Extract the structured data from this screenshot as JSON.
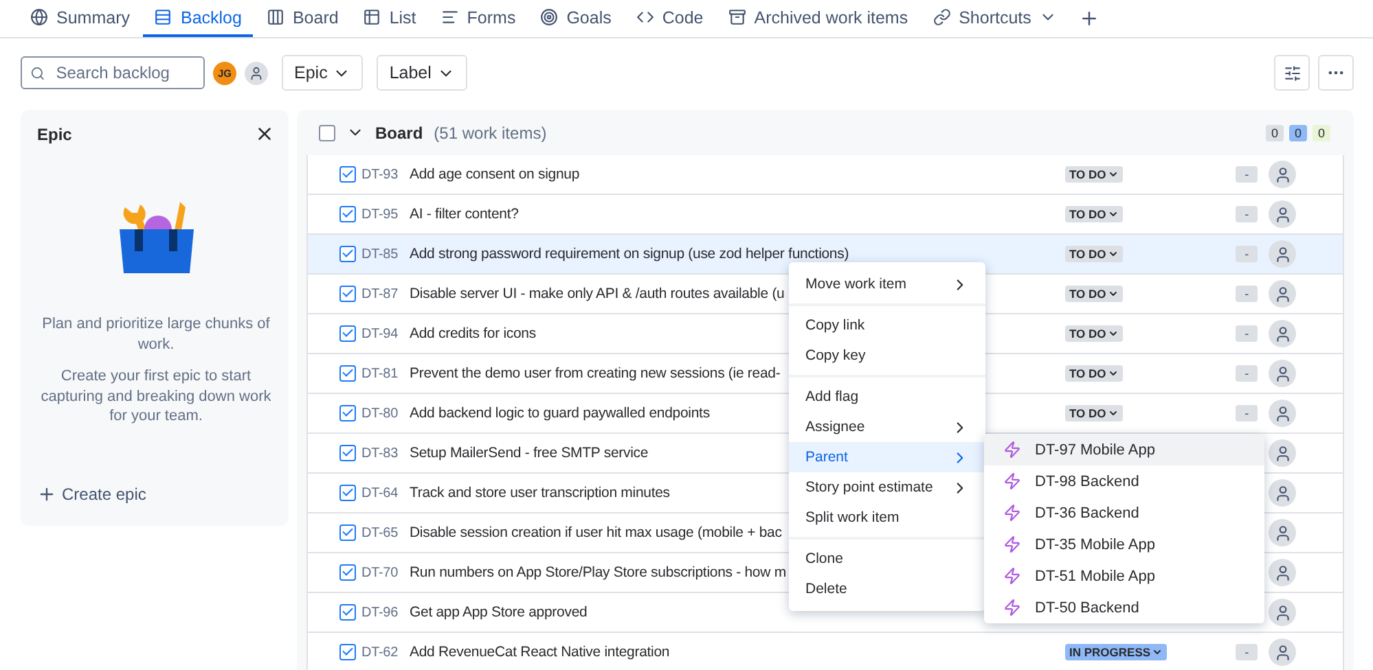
{
  "tabs": [
    {
      "label": "Summary",
      "selected": false
    },
    {
      "label": "Backlog",
      "selected": true
    },
    {
      "label": "Board",
      "selected": false
    },
    {
      "label": "List",
      "selected": false
    },
    {
      "label": "Forms",
      "selected": false
    },
    {
      "label": "Goals",
      "selected": false
    },
    {
      "label": "Code",
      "selected": false
    },
    {
      "label": "Archived work items",
      "selected": false
    },
    {
      "label": "Shortcuts",
      "selected": false
    }
  ],
  "toolbar": {
    "search": {
      "placeholder": "Search backlog"
    },
    "avatar_initials": "JG",
    "filters": [
      "Epic",
      "Label"
    ]
  },
  "epic_panel": {
    "title": "Epic",
    "text_1": "Plan and prioritize large chunks of work.",
    "text_2": "Create your first epic to start capturing and breaking down work for your team.",
    "create_label": "Create epic"
  },
  "board": {
    "title": "Board",
    "count": "(51 work items)",
    "checked": false,
    "expanded": true,
    "totals": [
      {
        "value": "0",
        "color": "#dcdfe4"
      },
      {
        "value": "0",
        "color": "#8fb8f6"
      },
      {
        "value": "0",
        "color": "#e9f5d6"
      }
    ],
    "rows": [
      {
        "key": "DT-93",
        "title": "Add age consent on signup",
        "checked": true,
        "selected": false,
        "status": "TO DO",
        "color": "#dcdfe4",
        "estimate": "-"
      },
      {
        "key": "DT-95",
        "title": "AI - filter content?",
        "checked": true,
        "selected": false,
        "status": "TO DO",
        "color": "#dcdfe4",
        "estimate": "-"
      },
      {
        "key": "DT-85",
        "title": "Add strong password requirement on signup (use zod helper functions)",
        "checked": true,
        "selected": true,
        "status": "TO DO",
        "color": "#dcdfe4",
        "estimate": "-"
      },
      {
        "key": "DT-87",
        "title": "Disable server UI - make only API & /auth routes available (u",
        "checked": true,
        "selected": false,
        "status": "TO DO",
        "color": "#dcdfe4",
        "estimate": "-"
      },
      {
        "key": "DT-94",
        "title": "Add credits for icons",
        "checked": true,
        "selected": false,
        "status": "TO DO",
        "color": "#dcdfe4",
        "estimate": "-"
      },
      {
        "key": "DT-81",
        "title": "Prevent the demo user from creating new sessions (ie read-",
        "checked": true,
        "selected": false,
        "status": "TO DO",
        "color": "#dcdfe4",
        "estimate": "-"
      },
      {
        "key": "DT-80",
        "title": "Add backend logic to guard paywalled endpoints",
        "checked": true,
        "selected": false,
        "status": "TO DO",
        "color": "#dcdfe4",
        "estimate": "-"
      },
      {
        "key": "DT-83",
        "title": "Setup MailerSend - free SMTP service",
        "checked": true,
        "selected": false
      },
      {
        "key": "DT-64",
        "title": "Track and store user transcription minutes",
        "checked": true,
        "selected": false
      },
      {
        "key": "DT-65",
        "title": "Disable session creation if user hit max usage (mobile + bac",
        "checked": true,
        "selected": false
      },
      {
        "key": "DT-70",
        "title": "Run numbers on App Store/Play Store subscriptions - how m",
        "checked": true,
        "selected": false
      },
      {
        "key": "DT-96",
        "title": "Get app App Store approved",
        "checked": true,
        "selected": false
      },
      {
        "key": "DT-62",
        "title": "Add RevenueCat React Native integration",
        "checked": true,
        "selected": false,
        "status": "IN PROGRESS",
        "color": "#8fb8f6",
        "estimate": "-"
      }
    ]
  },
  "context_menu": {
    "groups": [
      [
        {
          "label": "Move work item",
          "submenu": true,
          "selected": false
        }
      ],
      [
        {
          "label": "Copy link",
          "submenu": false,
          "selected": false
        },
        {
          "label": "Copy key",
          "submenu": false,
          "selected": false
        }
      ],
      [
        {
          "label": "Add flag",
          "submenu": false,
          "selected": false
        },
        {
          "label": "Assignee",
          "submenu": true,
          "selected": false
        },
        {
          "label": "Parent",
          "submenu": true,
          "selected": true
        },
        {
          "label": "Story point estimate",
          "submenu": true,
          "selected": false
        },
        {
          "label": "Split work item",
          "submenu": false,
          "selected": false
        }
      ],
      [
        {
          "label": "Clone",
          "submenu": false,
          "selected": false
        },
        {
          "label": "Delete",
          "submenu": false,
          "selected": false
        }
      ]
    ]
  },
  "parent_submenu": [
    {
      "label": "DT-97 Mobile App",
      "selected": true
    },
    {
      "label": "DT-98 Backend",
      "selected": false
    },
    {
      "label": "DT-36 Backend",
      "selected": false
    },
    {
      "label": "DT-35 Mobile App",
      "selected": false
    },
    {
      "label": "DT-51 Mobile App",
      "selected": false
    },
    {
      "label": "DT-50 Backend",
      "selected": false
    }
  ]
}
